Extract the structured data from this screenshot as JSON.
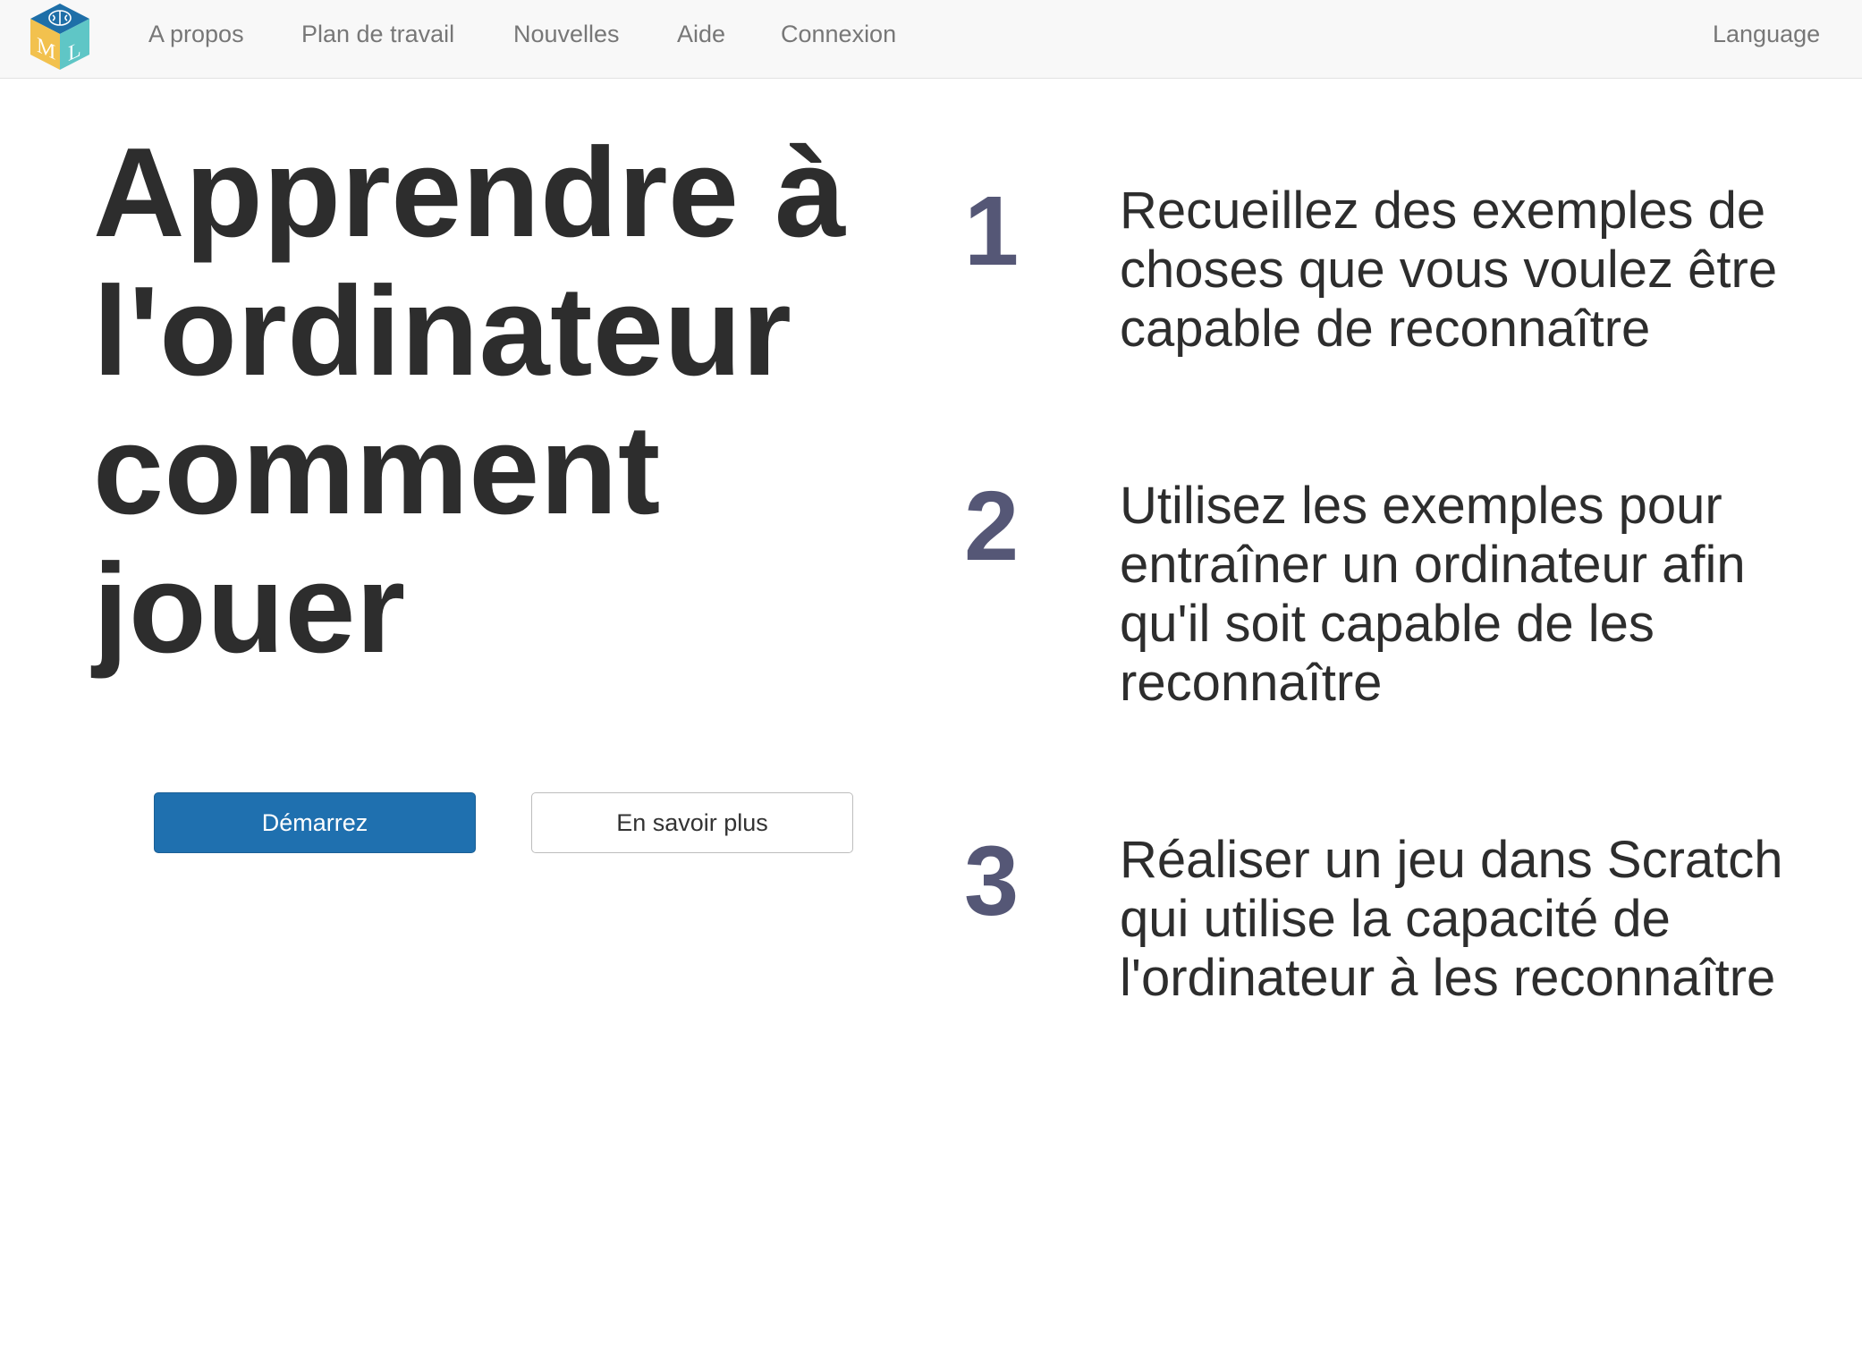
{
  "nav": {
    "logo_letters": "ML",
    "items": [
      "A propos",
      "Plan de travail",
      "Nouvelles",
      "Aide",
      "Connexion"
    ],
    "language": "Language"
  },
  "hero": {
    "title": "Apprendre à l'ordinateur comment jouer",
    "start_button": "Démarrez",
    "learn_more_button": "En savoir plus"
  },
  "steps": [
    {
      "number": "1",
      "text": "Recueillez des exemples de choses que vous voulez être capable de reconnaître"
    },
    {
      "number": "2",
      "text": "Utilisez les exemples pour entraîner un ordinateur afin qu'il soit capable de les reconnaître"
    },
    {
      "number": "3",
      "text": "Réaliser un jeu dans Scratch qui utilise la capacité de l'ordinateur à les reconnaître"
    }
  ],
  "colors": {
    "primary_button": "#1f70af",
    "step_number": "#555776",
    "navbar_bg": "#f8f8f8",
    "logo_top": "#1e6fa8",
    "logo_left": "#f2c14e",
    "logo_right": "#5fc6c6"
  }
}
